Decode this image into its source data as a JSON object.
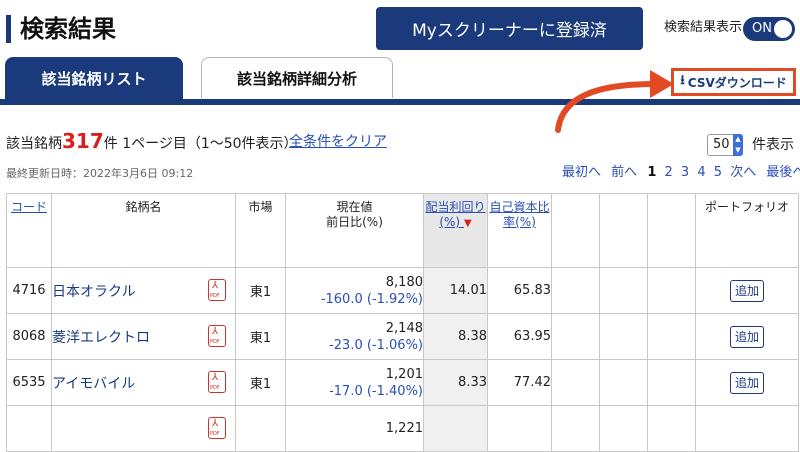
{
  "header": {
    "title": "検索結果",
    "screener_button": "Myスクリーナーに登録済",
    "toggle_label": "検索結果表示",
    "toggle_state": "ON"
  },
  "tabs": [
    {
      "label": "該当銘柄リスト",
      "active": true
    },
    {
      "label": "該当銘柄詳細分析",
      "active": false
    }
  ],
  "csv_download": "CSVダウンロード",
  "summary": {
    "prefix": "該当銘柄",
    "count": "317",
    "suffix": "件 1ページ目（1〜50件表示）",
    "clear_link": "全条件をクリア",
    "updated": "最終更新日時：2022年3月6日 09:12"
  },
  "page_size": {
    "value": "50",
    "suffix": "件表示"
  },
  "pager": {
    "first": "最初へ",
    "prev": "前へ",
    "pages": [
      "1",
      "2",
      "3",
      "4",
      "5"
    ],
    "current": "1",
    "next": "次へ",
    "last": "最後へ"
  },
  "table": {
    "headers": {
      "code": "コード",
      "name": "銘柄名",
      "market": "市場",
      "price": "現在値",
      "price_sub": "前日比(%)",
      "dividend": "配当利回り(%)",
      "equity": "自己資本比率(%)",
      "portfolio": "ポートフォリオ"
    },
    "pdf_label": "PDF",
    "add_label": "追加",
    "rows": [
      {
        "code": "4716",
        "name": "日本オラクル",
        "market": "東1",
        "price": "8,180",
        "change": "-160.0 (-1.92%)",
        "dividend": "14.01",
        "equity": "65.83"
      },
      {
        "code": "8068",
        "name": "菱洋エレクトロ",
        "market": "東1",
        "price": "2,148",
        "change": "-23.0 (-1.06%)",
        "dividend": "8.38",
        "equity": "63.95"
      },
      {
        "code": "6535",
        "name": "アイモバイル",
        "market": "東1",
        "price": "1,201",
        "change": "-17.0 (-1.40%)",
        "dividend": "8.33",
        "equity": "77.42"
      },
      {
        "code": "",
        "name": "",
        "market": "",
        "price": "1,221",
        "change": "",
        "dividend": "",
        "equity": ""
      }
    ]
  }
}
